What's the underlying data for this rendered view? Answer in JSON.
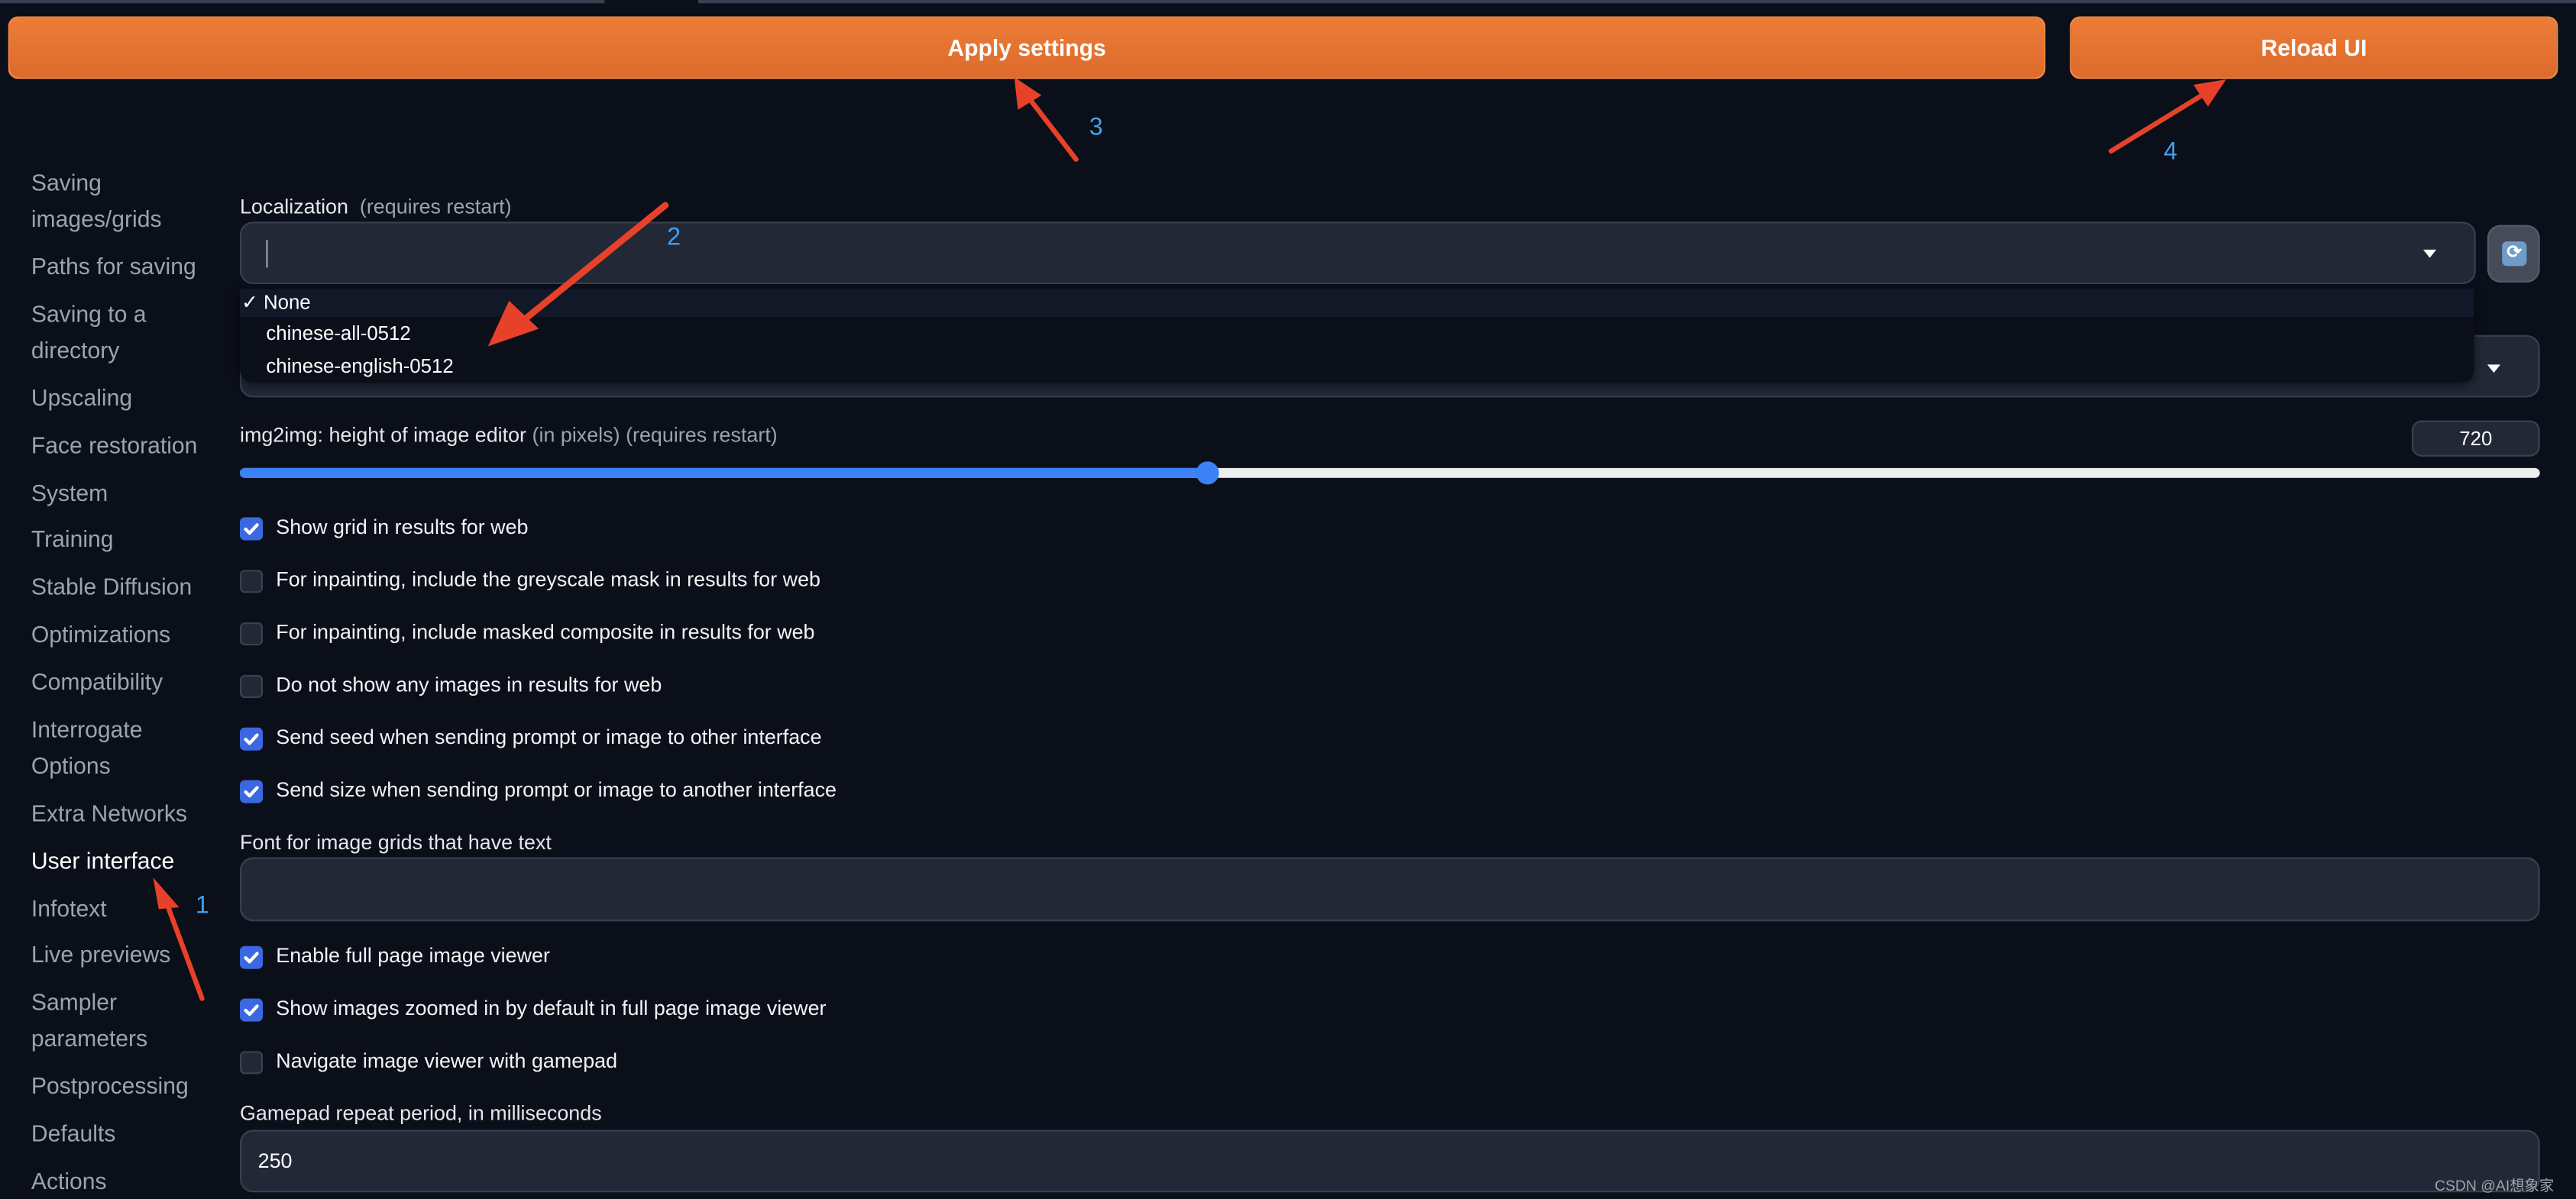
{
  "header": {
    "apply_label": "Apply settings",
    "reload_label": "Reload UI"
  },
  "sidebar": {
    "items": [
      {
        "label": "Saving images/grids"
      },
      {
        "label": "Paths for saving"
      },
      {
        "label": "Saving to a directory"
      },
      {
        "label": "Upscaling"
      },
      {
        "label": "Face restoration"
      },
      {
        "label": "System"
      },
      {
        "label": "Training"
      },
      {
        "label": "Stable Diffusion"
      },
      {
        "label": "Optimizations"
      },
      {
        "label": "Compatibility"
      },
      {
        "label": "Interrogate Options"
      },
      {
        "label": "Extra Networks"
      },
      {
        "label": "User interface",
        "active": true
      },
      {
        "label": "Infotext"
      },
      {
        "label": "Live previews"
      },
      {
        "label": "Sampler parameters"
      },
      {
        "label": "Postprocessing"
      },
      {
        "label": "Defaults"
      },
      {
        "label": "Actions"
      }
    ]
  },
  "main": {
    "localization": {
      "label": "Localization",
      "note": "(requires restart)",
      "value": "",
      "options": [
        {
          "label": "None",
          "selected": true,
          "check": "✓"
        },
        {
          "label": "chinese-all-0512"
        },
        {
          "label": "chinese-english-0512"
        }
      ],
      "refresh_icon": "refresh-icon"
    },
    "editor_height": {
      "label": "img2img: height of image editor",
      "note1": "(in pixels)",
      "note2": "(requires restart)",
      "value": "720",
      "min": 80,
      "max": 1600
    },
    "checkboxes_a": [
      {
        "label": "Show grid in results for web",
        "checked": true
      },
      {
        "label": "For inpainting, include the greyscale mask in results for web",
        "checked": false
      },
      {
        "label": "For inpainting, include masked composite in results for web",
        "checked": false
      },
      {
        "label": "Do not show any images in results for web",
        "checked": false
      },
      {
        "label": "Send seed when sending prompt or image to other interface",
        "checked": true
      },
      {
        "label": "Send size when sending prompt or image to another interface",
        "checked": true
      }
    ],
    "font": {
      "label": "Font for image grids that have text",
      "value": ""
    },
    "checkboxes_b": [
      {
        "label": "Enable full page image viewer",
        "checked": true
      },
      {
        "label": "Show images zoomed in by default in full page image viewer",
        "checked": true
      },
      {
        "label": "Navigate image viewer with gamepad",
        "checked": false
      }
    ],
    "gamepad": {
      "label": "Gamepad repeat period, in milliseconds",
      "value": "250"
    }
  },
  "annotations": {
    "n1": "1",
    "n2": "2",
    "n3": "3",
    "n4": "4",
    "arrow_color": "#e8412a",
    "number_color": "#3fa2f0"
  },
  "colors": {
    "accent": "#e0702f",
    "checkbox": "#3b67e0",
    "background": "#0b0f19"
  },
  "watermark": "CSDN @AI想象家"
}
